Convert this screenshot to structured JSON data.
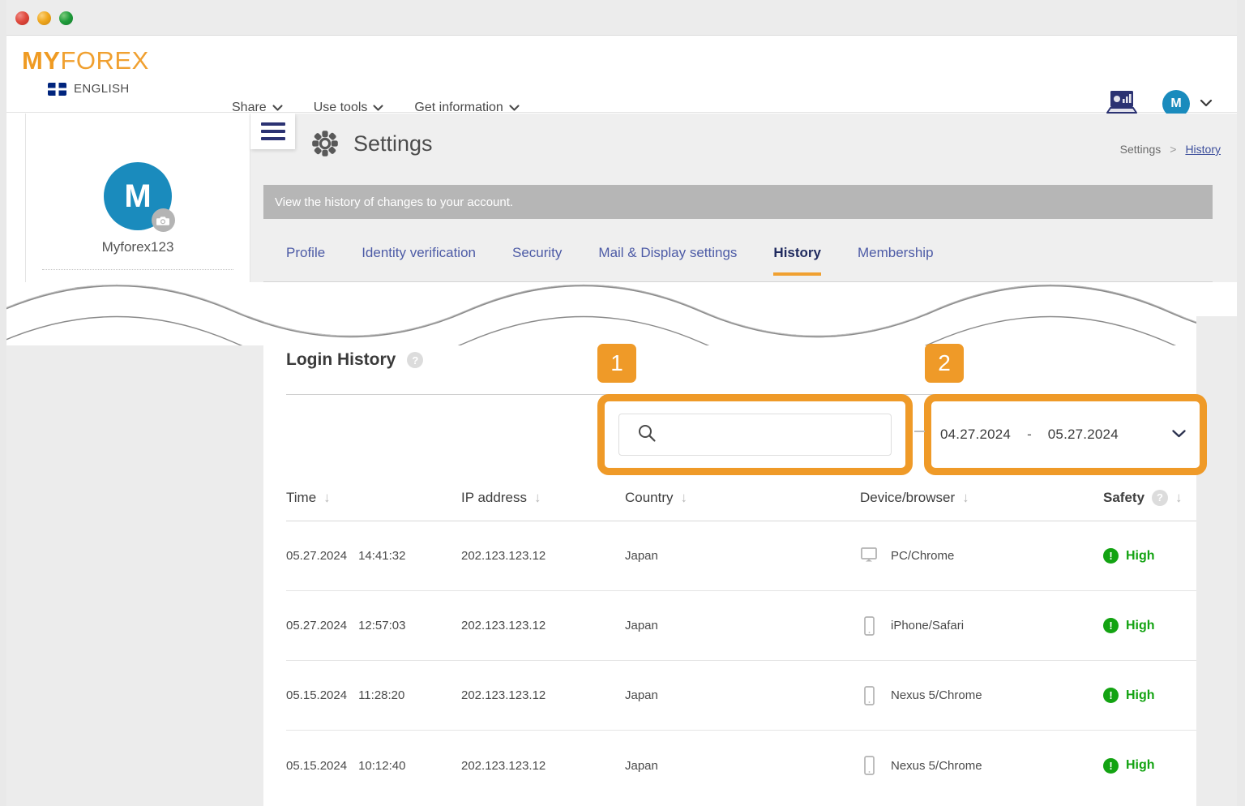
{
  "window": {
    "traffic_lights": [
      "close",
      "minimize",
      "maximize"
    ]
  },
  "header": {
    "logo_bold": "MY",
    "logo_light": "FOREX",
    "language": "ENGLISH",
    "flag_icon": "uk-flag-icon",
    "nav": [
      {
        "label": "Share",
        "icon": "chevron-down-icon"
      },
      {
        "label": "Use tools",
        "icon": "chevron-down-icon"
      },
      {
        "label": "Get information",
        "icon": "chevron-down-icon"
      }
    ],
    "platform_icon": "laptop-chart-icon",
    "avatar_initial": "M",
    "avatar_chevron": "chevron-down-icon",
    "accent_color": "#f0a030",
    "avatar_color": "#1a8bbd"
  },
  "profile": {
    "avatar_initial": "M",
    "camera_icon": "camera-icon",
    "username": "Myforex123"
  },
  "settings": {
    "menu_icon": "hamburger-menu-icon",
    "gear_icon": "gear-icon",
    "title": "Settings",
    "description": "View the history of changes to your account.",
    "breadcrumb": {
      "root": "Settings",
      "separator": ">",
      "current": "History"
    },
    "tabs": [
      {
        "label": "Profile",
        "active": false
      },
      {
        "label": "Identity verification",
        "active": false
      },
      {
        "label": "Security",
        "active": false
      },
      {
        "label": "Mail & Display settings",
        "active": false
      },
      {
        "label": "History",
        "active": true
      },
      {
        "label": "Membership",
        "active": false
      }
    ]
  },
  "login_history": {
    "section_title": "Login History",
    "section_help_icon": "help-icon",
    "help_glyph": "?",
    "callouts": [
      {
        "number": "1",
        "target": "search-box"
      },
      {
        "number": "2",
        "target": "date-range"
      }
    ],
    "search": {
      "icon": "search-icon",
      "value": "",
      "placeholder": ""
    },
    "date_range": {
      "start": "04.27.2024",
      "separator": "-",
      "end": "05.27.2024",
      "chevron": "chevron-down-icon"
    },
    "columns": [
      {
        "label": "Time",
        "sort_icon": "sort-down-arrow-icon",
        "bold": false
      },
      {
        "label": "IP address",
        "sort_icon": "sort-down-arrow-icon",
        "bold": false
      },
      {
        "label": "Country",
        "sort_icon": "sort-down-arrow-icon",
        "bold": false
      },
      {
        "label": "Device/browser",
        "sort_icon": "sort-down-arrow-icon",
        "bold": false
      },
      {
        "label": "Safety",
        "sort_icon": "sort-down-arrow-icon",
        "bold": true,
        "help_icon": "help-icon"
      }
    ],
    "sort_glyph": "↓",
    "rows": [
      {
        "date": "05.27.2024",
        "time": "14:41:32",
        "ip": "202.123.123.12",
        "country": "Japan",
        "device_icon": "monitor-icon",
        "device": "PC/Chrome",
        "safety": "High",
        "safety_icon": "exclamation-circle-icon",
        "safety_color": "#13a312"
      },
      {
        "date": "05.27.2024",
        "time": "12:57:03",
        "ip": "202.123.123.12",
        "country": "Japan",
        "device_icon": "smartphone-icon",
        "device": "iPhone/Safari",
        "safety": "High",
        "safety_icon": "exclamation-circle-icon",
        "safety_color": "#13a312"
      },
      {
        "date": "05.15.2024",
        "time": "11:28:20",
        "ip": "202.123.123.12",
        "country": "Japan",
        "device_icon": "smartphone-icon",
        "device": "Nexus 5/Chrome",
        "safety": "High",
        "safety_icon": "exclamation-circle-icon",
        "safety_color": "#13a312"
      },
      {
        "date": "05.15.2024",
        "time": "10:12:40",
        "ip": "202.123.123.12",
        "country": "Japan",
        "device_icon": "smartphone-icon",
        "device": "Nexus 5/Chrome",
        "safety": "High",
        "safety_icon": "exclamation-circle-icon",
        "safety_color": "#13a312"
      }
    ]
  }
}
